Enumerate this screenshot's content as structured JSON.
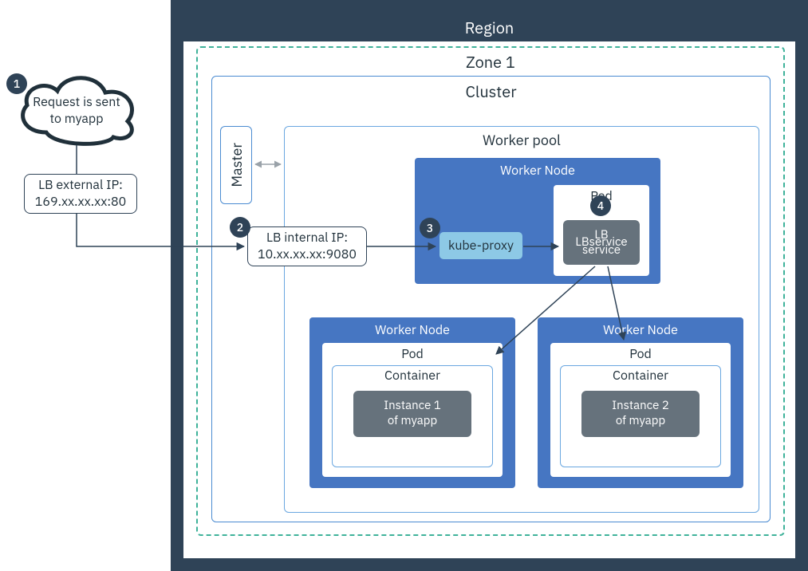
{
  "layout": {
    "region_label": "Region",
    "zone_label": "Zone 1",
    "cluster_label": "Cluster",
    "master_label": "Master",
    "workerpool_label": "Worker pool"
  },
  "cloud": {
    "text_line1": "Request is sent",
    "text_line2": "to myapp"
  },
  "lb_external": {
    "line1": "LB external IP:",
    "line2": "169.xx.xx.xx:80"
  },
  "lb_internal": {
    "line1": "LB internal IP:",
    "line2": "10.xx.xx.xx:9080"
  },
  "worker_top": {
    "node_label": "Worker Node",
    "pod_label": "Pod",
    "kubeproxy": "kube-proxy",
    "lbservice_line1": "LB",
    "lbservice_line2": "service"
  },
  "worker_left": {
    "node_label": "Worker Node",
    "pod_label": "Pod",
    "container_label": "Container",
    "instance_line1": "Instance 1",
    "instance_line2": "of myapp"
  },
  "worker_right": {
    "node_label": "Worker Node",
    "pod_label": "Pod",
    "container_label": "Container",
    "instance_line1": "Instance 2",
    "instance_line2": "of myapp"
  },
  "badges": {
    "b1": "1",
    "b2": "2",
    "b3": "3",
    "b4": "4"
  }
}
